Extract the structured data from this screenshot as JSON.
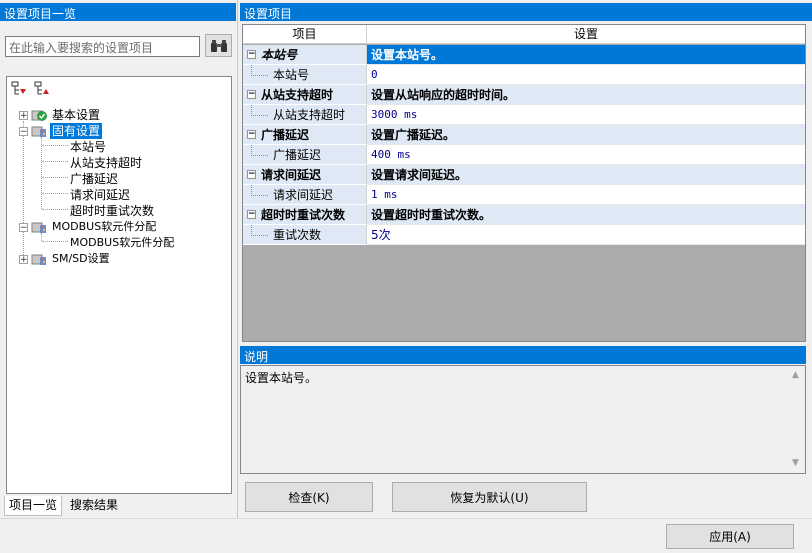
{
  "left_panel": {
    "title": "设置项目一览",
    "search": {
      "placeholder": "在此输入要搜索的设置项目"
    },
    "tree": [
      {
        "label": "基本设置",
        "icon": "settings-ok-icon",
        "expanded": false
      },
      {
        "label": "固有设置",
        "icon": "settings-folder-icon",
        "expanded": true,
        "selected": true,
        "children": [
          "本站号",
          "从站支持超时",
          "广播延迟",
          "请求间延迟",
          "超时时重试次数"
        ]
      },
      {
        "label": "MODBUS软元件分配",
        "icon": "settings-folder-icon",
        "expanded": true,
        "children": [
          "MODBUS软元件分配"
        ]
      },
      {
        "label": "SM/SD设置",
        "icon": "settings-folder-icon",
        "expanded": false
      }
    ],
    "tabs": [
      "项目一览",
      "搜索结果"
    ]
  },
  "right_panel": {
    "title": "设置项目",
    "columns": [
      "项目",
      "设置"
    ],
    "groups": [
      {
        "category": "本站号",
        "description": "设置本站号。",
        "item": "本站号",
        "value": "0"
      },
      {
        "category": "从站支持超时",
        "description": "设置从站响应的超时时间。",
        "item": "从站支持超时",
        "value": "3000 ms"
      },
      {
        "category": "广播延迟",
        "description": "设置广播延迟。",
        "item": "广播延迟",
        "value": "400 ms"
      },
      {
        "category": "请求间延迟",
        "description": "设置请求间延迟。",
        "item": "请求间延迟",
        "value": "1 ms"
      },
      {
        "category": "超时时重试次数",
        "description": "设置超时时重试次数。",
        "item": "重试次数",
        "value": "5次"
      }
    ]
  },
  "description_panel": {
    "title": "说明",
    "text": "设置本站号。"
  },
  "buttons": {
    "check": "检查(K)",
    "restore": "恢复为默认(U)",
    "apply": "应用(A)"
  },
  "colors": {
    "accent": "#0078d7",
    "category_bg": "#dfe9f5",
    "value_text": "#00008b"
  }
}
